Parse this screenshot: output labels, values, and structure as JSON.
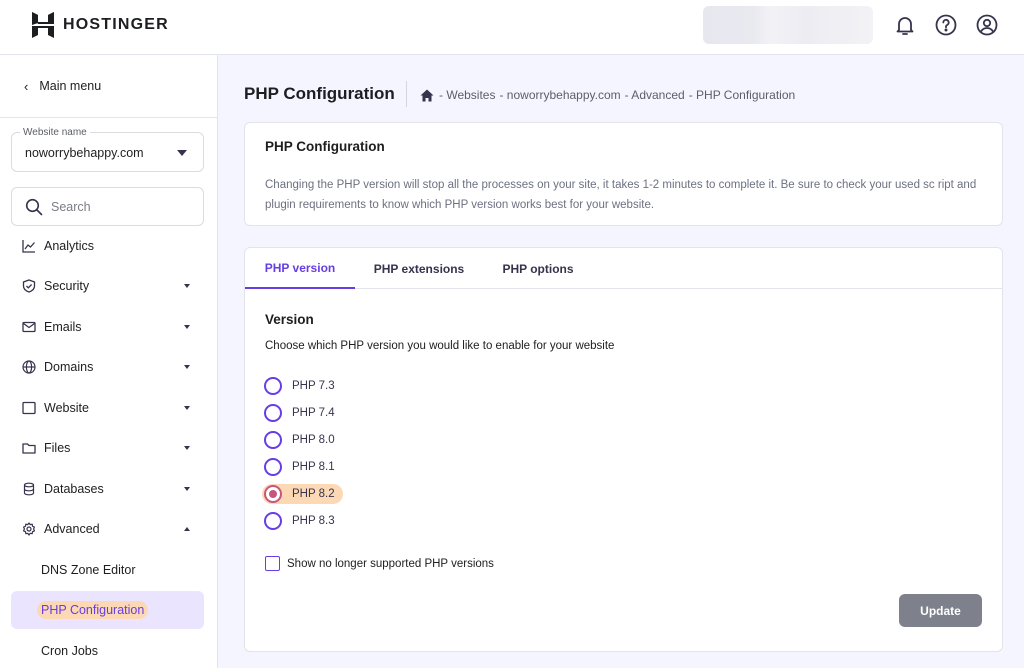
{
  "header": {
    "brand": "HOSTINGER",
    "icons": [
      "hostinger-logo-icon",
      "bell-icon",
      "help-icon",
      "account-icon"
    ]
  },
  "sidebar": {
    "main_menu_label": "Main menu",
    "website_select": {
      "legend": "Website name",
      "value": "noworrybehappy.com"
    },
    "search_placeholder": "Search",
    "items": [
      {
        "label": "Analytics",
        "icon": "chart-icon",
        "dropdown": "none"
      },
      {
        "label": "Security",
        "icon": "shield-icon",
        "dropdown": "down"
      },
      {
        "label": "Emails",
        "icon": "mail-icon",
        "dropdown": "down"
      },
      {
        "label": "Domains",
        "icon": "globe-icon",
        "dropdown": "down"
      },
      {
        "label": "Website",
        "icon": "window-icon",
        "dropdown": "down"
      },
      {
        "label": "Files",
        "icon": "folder-icon",
        "dropdown": "down"
      },
      {
        "label": "Databases",
        "icon": "database-icon",
        "dropdown": "down"
      },
      {
        "label": "Advanced",
        "icon": "gear-icon",
        "dropdown": "up"
      }
    ],
    "sub_items": [
      {
        "label": "DNS Zone Editor",
        "active": false
      },
      {
        "label": "PHP Configuration",
        "active": true
      },
      {
        "label": "Cron Jobs",
        "active": false
      }
    ]
  },
  "main": {
    "page_title": "PHP Configuration",
    "breadcrumb": [
      "- Websites",
      "- noworrybehappy.com",
      "- Advanced",
      "- PHP Configuration"
    ],
    "info_card": {
      "title": "PHP Configuration",
      "text": "Changing the PHP version will stop all the processes on your site, it takes 1-2 minutes to complete it. Be sure to check your used sc ript and plugin requirements to know which PHP version works best for your website."
    },
    "tabs": [
      {
        "label": "PHP version",
        "active": true
      },
      {
        "label": "PHP extensions",
        "active": false
      },
      {
        "label": "PHP options",
        "active": false
      }
    ],
    "version_section": {
      "title": "Version",
      "description": "Choose which PHP version you would like to enable for your website",
      "options": [
        "PHP 7.3",
        "PHP 7.4",
        "PHP 8.0",
        "PHP 8.1",
        "PHP 8.2",
        "PHP 8.3"
      ],
      "selected": "PHP 8.2",
      "show_unsupported_label": "Show no longer supported PHP versions",
      "show_unsupported_checked": false,
      "update_label": "Update"
    }
  },
  "colors": {
    "accent": "#673de6",
    "highlight": "#fcd9b4",
    "button_disabled": "#7e818c"
  }
}
